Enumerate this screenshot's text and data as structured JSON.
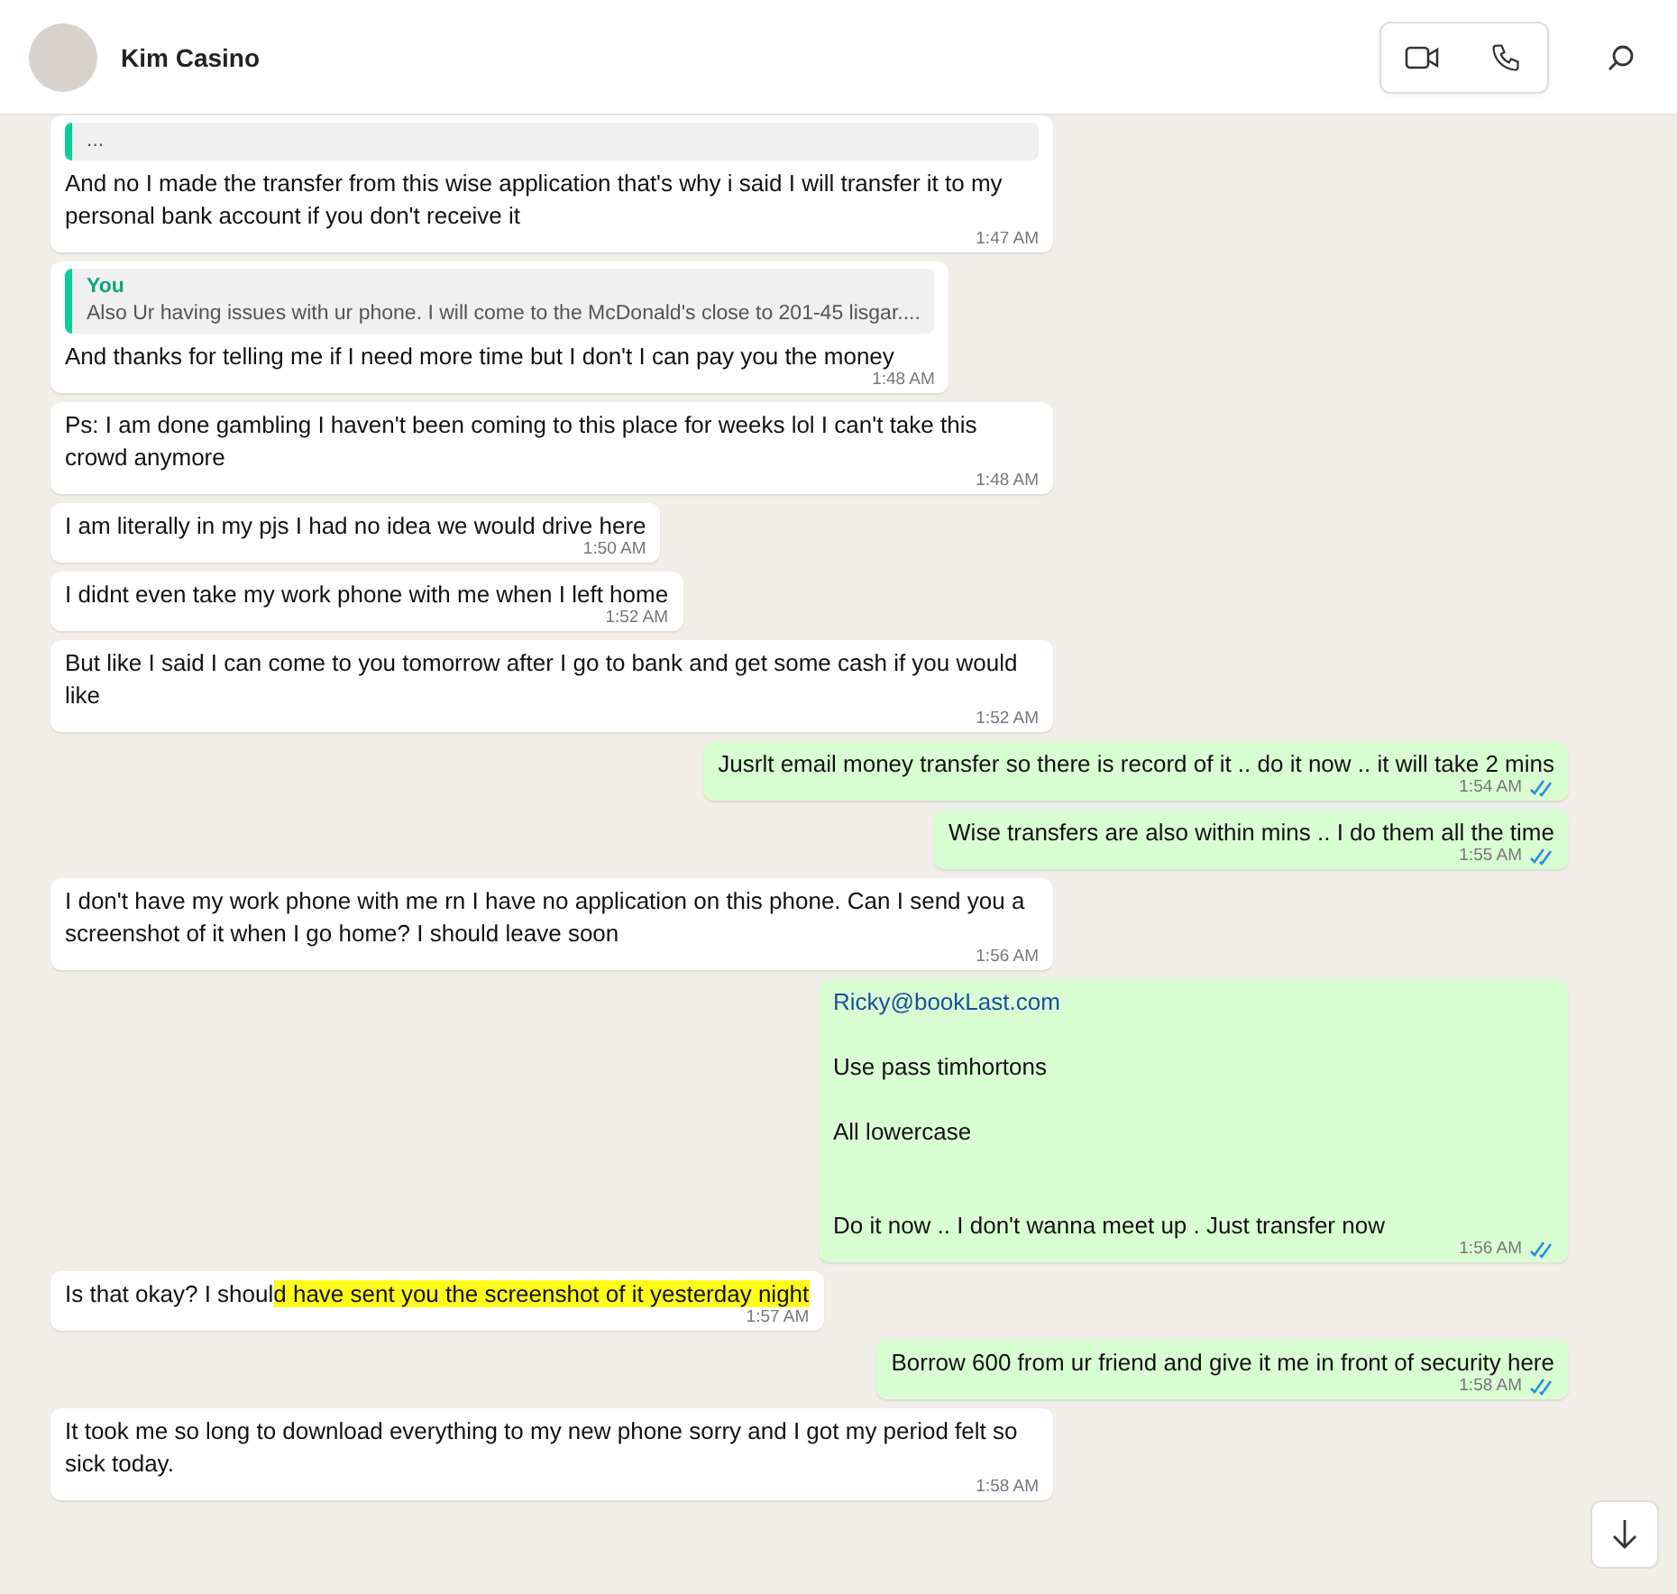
{
  "header": {
    "contact_name": "Kim Casino"
  },
  "messages": [
    {
      "kind": "received",
      "quote": {
        "text": "..."
      },
      "parts": [
        {
          "text": "And no I made the transfer from this wise application that's why i said I will transfer it to my personal bank account if you don't receive it",
          "highlighted": false
        }
      ],
      "time": "1:47 AM"
    },
    {
      "kind": "received",
      "quote": {
        "author": "You",
        "text": "Also Ur having issues with ur phone. I will come to the McDonald's close to 201-45 lisgar...."
      },
      "parts": [
        {
          "text": "And thanks for telling me if I need more time but I don't I can pay you the money",
          "highlighted": false
        }
      ],
      "time": "1:48 AM"
    },
    {
      "kind": "received",
      "parts": [
        {
          "text": "Ps: I am done gambling I haven't been coming to this place for weeks lol I can't take this crowd anymore",
          "highlighted": false
        }
      ],
      "time": "1:48 AM"
    },
    {
      "kind": "received",
      "parts": [
        {
          "text": "I am literally in my pjs I had no idea we would drive here",
          "highlighted": false
        }
      ],
      "time": "1:50 AM"
    },
    {
      "kind": "received",
      "parts": [
        {
          "text": "I didnt even take my work phone with me when I left home",
          "highlighted": false
        }
      ],
      "time": "1:52 AM"
    },
    {
      "kind": "received",
      "parts": [
        {
          "text": "But like I said I can come to you tomorrow after I go to bank and get  some cash if you would like",
          "highlighted": false
        }
      ],
      "time": "1:52 AM"
    },
    {
      "kind": "sent",
      "read": true,
      "parts": [
        {
          "text": "Jusrlt email money transfer so there is record of it .. do it now .. it will take 2 mins",
          "highlighted": false
        }
      ],
      "time": "1:54 AM"
    },
    {
      "kind": "sent",
      "read": true,
      "parts": [
        {
          "text": "Wise transfers are also within mins .. I do them all the time",
          "highlighted": false
        }
      ],
      "time": "1:55 AM"
    },
    {
      "kind": "received",
      "parts": [
        {
          "text": "I don't have my work phone with me rn I have no application on this phone. Can I send you a screenshot of it when I go home? I should leave soon",
          "highlighted": false
        }
      ],
      "time": "1:56 AM"
    },
    {
      "kind": "sent",
      "read": true,
      "lines": [
        {
          "kind": "link",
          "text": "Ricky@bookLast.com"
        },
        {
          "kind": "text",
          "text": "Use pass  timhortons"
        },
        {
          "kind": "text",
          "text": "All lowercase"
        },
        {
          "kind": "text",
          "text": "Do it now ..  I don't wanna meet up  . Just transfer now"
        }
      ],
      "time": "1:56 AM"
    },
    {
      "kind": "received",
      "parts": [
        {
          "text": "Is that okay? I shoul",
          "highlighted": false
        },
        {
          "text": "d have sent you the screenshot of it yesterday night",
          "highlighted": true
        }
      ],
      "time": "1:57 AM"
    },
    {
      "kind": "sent",
      "read": true,
      "parts": [
        {
          "text": "Borrow 600 from ur friend and give it me in front of security here",
          "highlighted": false
        }
      ],
      "time": "1:58 AM"
    },
    {
      "kind": "received",
      "parts": [
        {
          "text": "It took me so long to download everything to my new phone sorry and I got my period felt so sick today.",
          "highlighted": false
        }
      ],
      "time": "1:58 AM"
    }
  ]
}
